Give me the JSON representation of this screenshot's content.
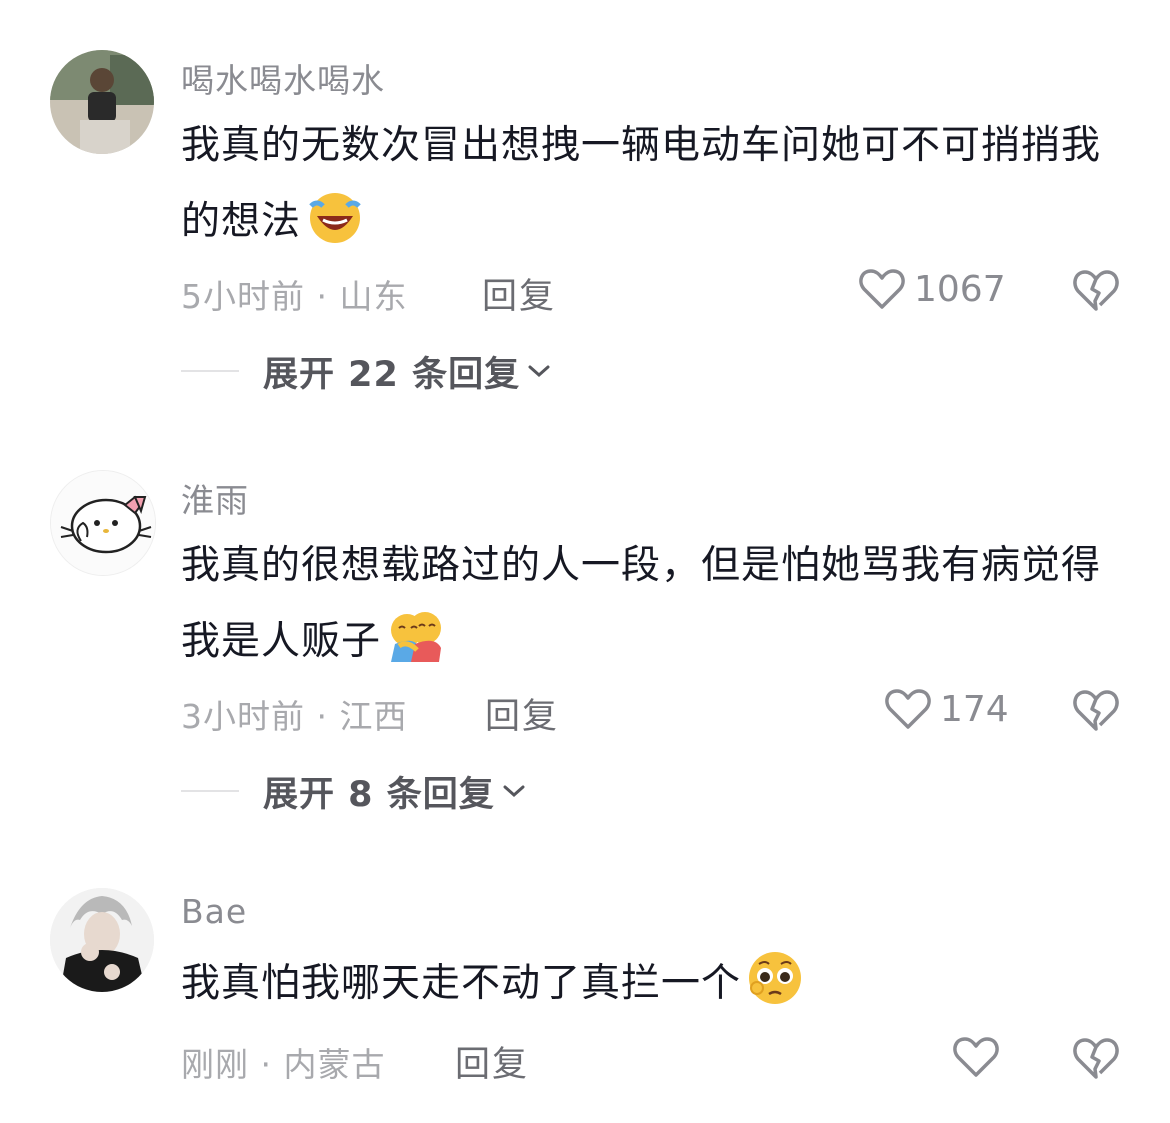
{
  "comments": [
    {
      "username": "喝水喝水喝水",
      "text": "我真的无数次冒出想拽一辆电动车问她可不可捎捎我的想法",
      "emoji": "laughing-crying-emoji",
      "time": "5小时前",
      "separator": "·",
      "location": "山东",
      "reply_label": "回复",
      "likes": "1067",
      "expand_label": "展开 22 条回复"
    },
    {
      "username": "淮雨",
      "text": "我真的很想载路过的人一段，但是怕她骂我有病觉得我是人贩子",
      "emoji": "hugging-emoji",
      "time": "3小时前",
      "separator": "·",
      "location": "江西",
      "reply_label": "回复",
      "likes": "174",
      "expand_label": "展开 8 条回复"
    },
    {
      "username": "Bae",
      "text": "我真怕我哪天走不动了真拦一个",
      "emoji": "pleading-emoji",
      "time": "刚刚",
      "separator": "·",
      "location": "内蒙古",
      "reply_label": "回复",
      "likes": ""
    }
  ],
  "icons": {
    "like": "heart-outline-icon",
    "dislike": "broken-heart-icon",
    "expand": "chevron-down-icon"
  },
  "colors": {
    "text": "#161823",
    "secondary": "#a8a9ad",
    "username": "#8a8b91"
  }
}
